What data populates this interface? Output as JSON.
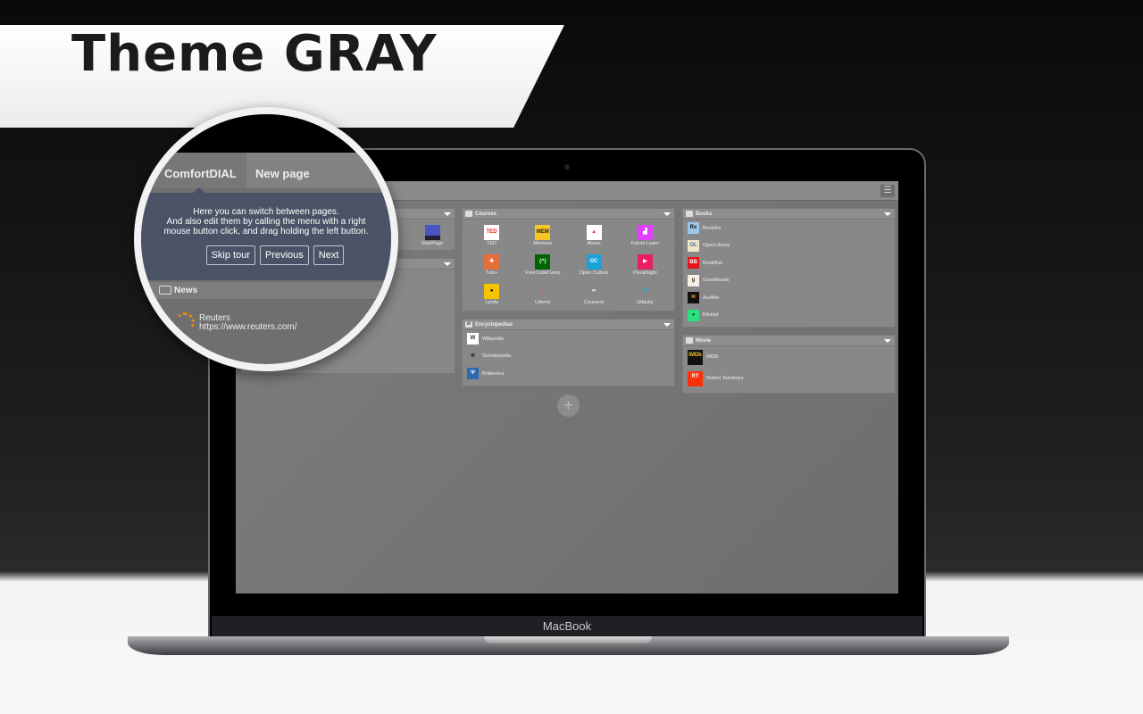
{
  "banner": {
    "title": "Theme GRAY"
  },
  "laptop": {
    "brand": "MacBook"
  },
  "app": {
    "menu_icon": "hamburger-icon",
    "tabs": [
      {
        "label": "ComfortDIAL",
        "active": true
      },
      {
        "label": "New page",
        "active": false
      }
    ],
    "tour": {
      "lines": [
        "Here you can switch between pages.",
        "And also edit them by calling the menu with a right",
        "mouse button click, and drag holding the left button."
      ],
      "buttons": {
        "skip": "Skip tour",
        "previous": "Previous",
        "next": "Next"
      }
    },
    "col1": {
      "widget_top": {
        "items": [
          {
            "label": "StartPage",
            "color": "#4a55c8"
          }
        ]
      },
      "news": {
        "title": "News",
        "items": [
          {
            "name": "Reuters",
            "url": "https://www.reuters.com/"
          }
        ]
      }
    },
    "courses": {
      "title": "Courses",
      "items": [
        {
          "label": "TED",
          "icon": "TED",
          "bg": "#ffffff",
          "fg": "#e62b1e"
        },
        {
          "label": "Memrise",
          "icon": "MEM",
          "bg": "#f6c526",
          "fg": "#222"
        },
        {
          "label": "Alison",
          "icon": "▲",
          "bg": "#ffffff",
          "fg": "#e53935"
        },
        {
          "label": "Future Learn",
          "icon": "▟",
          "bg": "#e040fb",
          "fg": "#fff"
        },
        {
          "label": "Tuts+",
          "icon": "✚",
          "bg": "#e5703a",
          "fg": "#fff"
        },
        {
          "label": "FreeCodeCamp",
          "icon": "(^)",
          "bg": "#006400",
          "fg": "#fff"
        },
        {
          "label": "Open Culture",
          "icon": "OC",
          "bg": "#1aa3d9",
          "fg": "#fff"
        },
        {
          "label": "PluralSight",
          "icon": "▶",
          "bg": "#e91e63",
          "fg": "#fff"
        },
        {
          "label": "Lynda",
          "icon": "●",
          "bg": "#f5c400",
          "fg": "#000"
        },
        {
          "label": "Udemy",
          "icon": "u",
          "bg": "transparent",
          "fg": "#ec5252"
        },
        {
          "label": "Coursera",
          "icon": "∞",
          "bg": "transparent",
          "fg": "#fff"
        },
        {
          "label": "Udacity",
          "icon": "U",
          "bg": "transparent",
          "fg": "#02b3e4"
        }
      ]
    },
    "encyclopedias": {
      "title": "Encyclopedias",
      "items": [
        {
          "label": "Wikipedia",
          "icon": "W",
          "bg": "#ffffff",
          "fg": "#333"
        },
        {
          "label": "Scholarpedia",
          "icon": "✺",
          "bg": "transparent",
          "fg": "#444"
        },
        {
          "label": "Britannica",
          "icon": "Ψ",
          "bg": "#2b6cb0",
          "fg": "#fff"
        }
      ]
    },
    "books": {
      "title": "Books",
      "items": [
        {
          "label": "BookRix",
          "icon": "Rx",
          "bg": "#9ec6e8",
          "fg": "#111"
        },
        {
          "label": "OpenLibrary",
          "icon": "OL",
          "bg": "#efe6c8",
          "fg": "#3a6ea5"
        },
        {
          "label": "BookBub",
          "icon": "BB",
          "bg": "#e3141b",
          "fg": "#fff"
        },
        {
          "label": "GoodReads",
          "icon": "g",
          "bg": "#f4f1ea",
          "fg": "#553b08"
        },
        {
          "label": "Audible",
          "icon": "≋",
          "bg": "#111",
          "fg": "#f7991c"
        },
        {
          "label": "Blinkist",
          "icon": "●",
          "bg": "#2ce080",
          "fg": "#0b3b5b"
        }
      ]
    },
    "movie": {
      "title": "Movie",
      "items": [
        {
          "label": "IMDb",
          "icon": "IMDb",
          "bg": "#111",
          "fg": "#f5c518"
        },
        {
          "label": "Rotten Tomatoes",
          "icon": "RT",
          "bg": "#fa320a",
          "fg": "#fff"
        }
      ]
    },
    "add_button": "+"
  }
}
